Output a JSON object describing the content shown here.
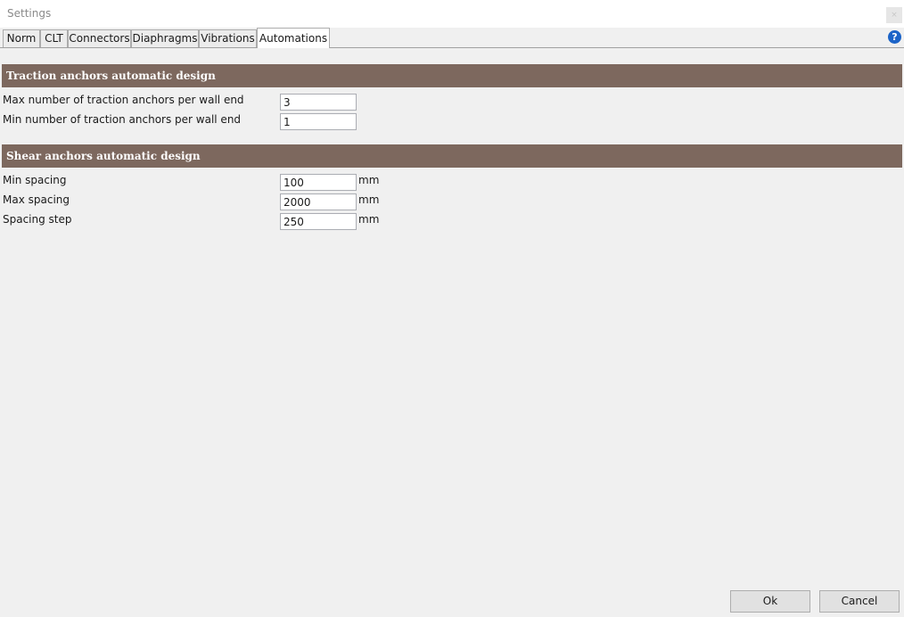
{
  "window": {
    "title": "Settings",
    "close_glyph": "×"
  },
  "tabs": [
    {
      "label": "Norm",
      "active": false
    },
    {
      "label": "CLT",
      "active": false
    },
    {
      "label": "Connectors",
      "active": false
    },
    {
      "label": "Diaphragms",
      "active": false
    },
    {
      "label": "Vibrations",
      "active": false
    },
    {
      "label": "Automations",
      "active": true
    }
  ],
  "help_icon": {
    "icon": "help-icon",
    "glyph": "?",
    "color": "#1c64c8"
  },
  "traction": {
    "header": "Traction anchors automatic design",
    "fields": [
      {
        "label": "Max number of traction anchors per wall end",
        "value": "3"
      },
      {
        "label": "Min number of traction anchors per wall end",
        "value": "1"
      }
    ]
  },
  "shear": {
    "header": "Shear anchors automatic design",
    "fields": [
      {
        "label": "Min spacing",
        "value": "100",
        "unit": "mm"
      },
      {
        "label": "Max spacing",
        "value": "2000",
        "unit": "mm"
      },
      {
        "label": "Spacing step",
        "value": "250",
        "unit": "mm"
      }
    ]
  },
  "buttons": {
    "ok": "Ok",
    "cancel": "Cancel"
  },
  "colors": {
    "section_header": "#7d685e",
    "background": "#f0f0f0"
  }
}
